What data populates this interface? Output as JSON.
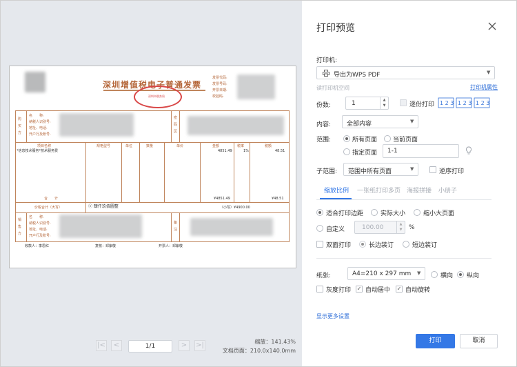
{
  "dialog": {
    "title": "打印预览",
    "close_icon": "close-icon"
  },
  "invoice": {
    "title": "深圳增值税电子普通发票",
    "seal_text": "深圳市税务局",
    "meta_labels": [
      "发票代码:",
      "发票号码:",
      "开票日期:",
      "校验码:"
    ],
    "buyer_side_label": "购买方",
    "buyer_labels": [
      "名　　称:",
      "纳税人识别号:",
      "地址、电话:",
      "开户行及账号:"
    ],
    "pwd_label": "密码区",
    "headers": [
      "项目名称",
      "规格型号",
      "单位",
      "数量",
      "单价",
      "金额",
      "税率",
      "税额"
    ],
    "item_name": "*信息技术服务*技术服务费",
    "item_amount": "4851.49",
    "item_rate": "1%",
    "item_tax": "48.51",
    "subtotal_label": "合　　计",
    "subtotal_amount": "¥4851.49",
    "subtotal_tax": "¥48.51",
    "total_label": "价税合计（大写）",
    "total_words": "ⓧ 肆仟玖佰圆整",
    "total_small": "（小写）¥4900.00",
    "seller_side_label": "销售方",
    "seller_labels": [
      "名　　称:",
      "纳税人识别号:",
      "地址、电话:",
      "开户行及账号:"
    ],
    "remark_label": "备注",
    "payee": "收款人：李思红",
    "reviewer": "复核：邓紫敬",
    "drawer": "开票人：邓紫敬"
  },
  "pager": {
    "first": "|<",
    "prev": "<",
    "page": "1/1",
    "next": ">",
    "last": ">|",
    "zoom": "缩放：141.43%",
    "doc_page": "文档页面：210.0x140.0mm"
  },
  "printer": {
    "label": "打印机:",
    "value": "导出为WPS PDF",
    "icon": "printer-icon",
    "read_link": "读打印机空间",
    "props_link": "打印机属性"
  },
  "copies": {
    "label": "份数:",
    "value": "1",
    "collate": "逐份打印",
    "collate_icons": "123 123 123"
  },
  "content": {
    "label": "内容:",
    "value": "全部内容"
  },
  "range": {
    "label": "范围:",
    "all": "所有页面",
    "current": "当前页面",
    "specified": "指定页面",
    "specified_value": "1-1",
    "bulb_icon": "lightbulb-icon"
  },
  "subrange": {
    "label": "子范围:",
    "value": "范围中所有页面",
    "reverse": "逆序打印"
  },
  "tabs": [
    "缩放比例",
    "一张纸打印多页",
    "海报拼接",
    "小册子"
  ],
  "scale": {
    "fit": "适合打印边距",
    "actual": "实际大小",
    "shrink": "缩小大页面",
    "custom": "自定义",
    "custom_value": "100.00",
    "unit": "%",
    "duplex": "双面打印",
    "long_edge": "长边装订",
    "short_edge": "短边装订"
  },
  "paper": {
    "label": "纸张:",
    "value": "A4=210 x 297 mm",
    "landscape": "横向",
    "portrait": "纵向",
    "grayscale": "灰度打印",
    "auto_center": "自动居中",
    "auto_rotate": "自动旋转"
  },
  "more_settings": "显示更多设置",
  "buttons": {
    "print": "打印",
    "cancel": "取消"
  },
  "colors": {
    "accent": "#3478e6",
    "link": "#2f6fd8",
    "invoice": "#b5673a"
  }
}
